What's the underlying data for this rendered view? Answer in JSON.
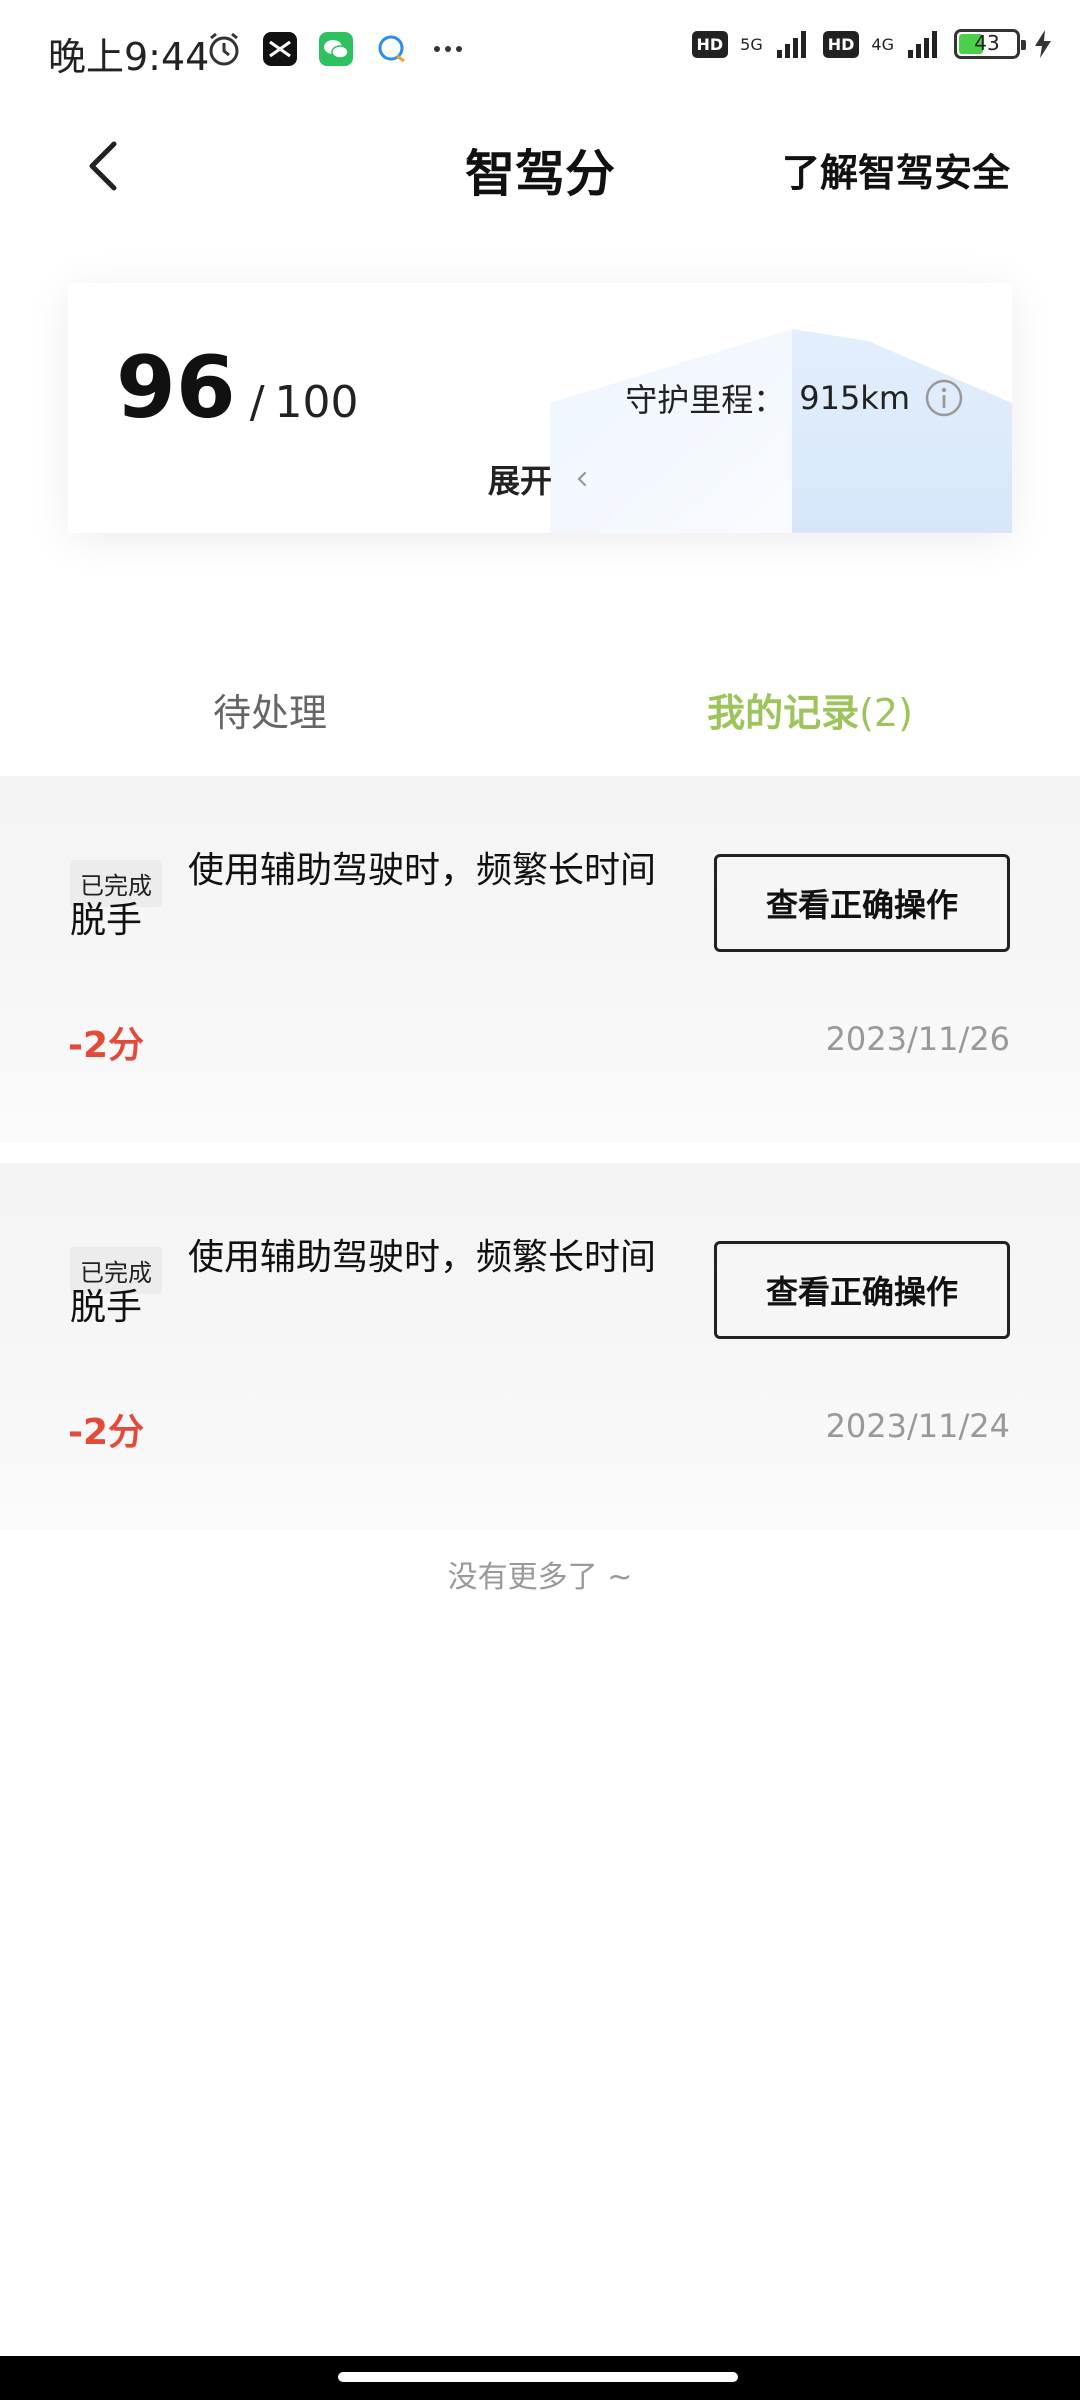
{
  "status_bar": {
    "time": "晚上9:44",
    "notification_icons": [
      "alarm-icon",
      "capcut-icon",
      "wechat-icon",
      "chat-bubble-icon",
      "more-dots-icon"
    ],
    "network": [
      {
        "badge": "HD",
        "type": "5G"
      },
      {
        "badge": "HD",
        "type": "4G"
      }
    ],
    "battery": "43",
    "battery_color": "#4cd04c"
  },
  "header": {
    "title": "智驾分",
    "link_label": "了解智驾安全"
  },
  "score_card": {
    "score": "96",
    "separator": "/",
    "total": "100",
    "mileage_label": "守护里程：",
    "mileage_value": "915km",
    "expand_label": "展开"
  },
  "tabs": {
    "pending": "待处理",
    "records": "我的记录",
    "records_count": "(2)",
    "active_color": "#9cc45a"
  },
  "records": [
    {
      "status": "已完成",
      "description": "使用辅助驾驶时，频繁长时间脱手",
      "action_label": "查看正确操作",
      "score_change": "-2分",
      "date": "2023/11/26"
    },
    {
      "status": "已完成",
      "description": "使用辅助驾驶时，频繁长时间脱手",
      "action_label": "查看正确操作",
      "score_change": "-2分",
      "date": "2023/11/24"
    }
  ],
  "end_message": "没有更多了 ~",
  "colors": {
    "penalty": "#e4493a",
    "muted": "#999999"
  }
}
